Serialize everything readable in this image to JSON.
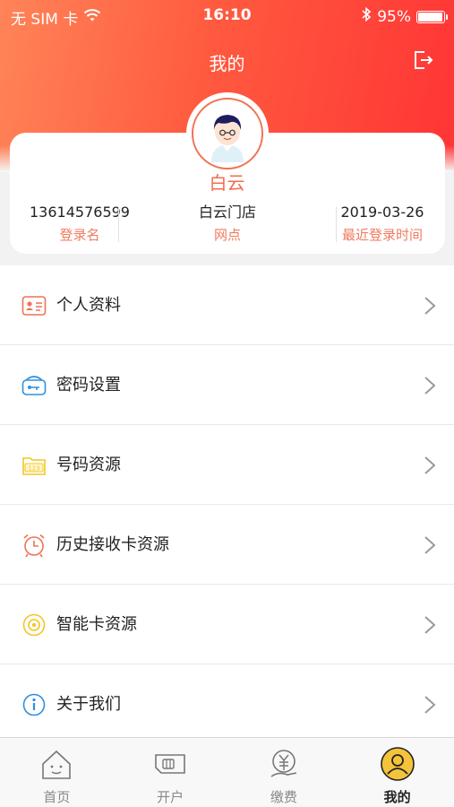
{
  "status_bar": {
    "carrier": "无 SIM 卡",
    "time": "16:10",
    "battery": "95%",
    "battery_level": 0.95
  },
  "header": {
    "title": "我的",
    "logout_icon": "logout-icon"
  },
  "profile": {
    "name": "白云",
    "stats": [
      {
        "value": "13614576599",
        "label": "登录名"
      },
      {
        "value": "白云门店",
        "label": "网点"
      },
      {
        "value": "2019-03-26",
        "label": "最近登录时间"
      }
    ]
  },
  "menu": [
    {
      "label": "个人资料",
      "icon": "id-card-icon"
    },
    {
      "label": "密码设置",
      "icon": "key-card-icon"
    },
    {
      "label": "号码资源",
      "icon": "folder-123-icon"
    },
    {
      "label": "历史接收卡资源",
      "icon": "alarm-clock-icon"
    },
    {
      "label": "智能卡资源",
      "icon": "chip-card-icon"
    },
    {
      "label": "关于我们",
      "icon": "info-icon"
    }
  ],
  "tabbar": [
    {
      "label": "首页",
      "icon": "home-icon"
    },
    {
      "label": "开户",
      "icon": "sim-card-icon"
    },
    {
      "label": "缴费",
      "icon": "payment-icon"
    },
    {
      "label": "我的",
      "icon": "user-icon",
      "active": true
    }
  ],
  "colors": {
    "accent": "#f26b4f",
    "header_start": "#ff8458",
    "header_end": "#ff3535",
    "active_tab": "#f5c33b"
  }
}
